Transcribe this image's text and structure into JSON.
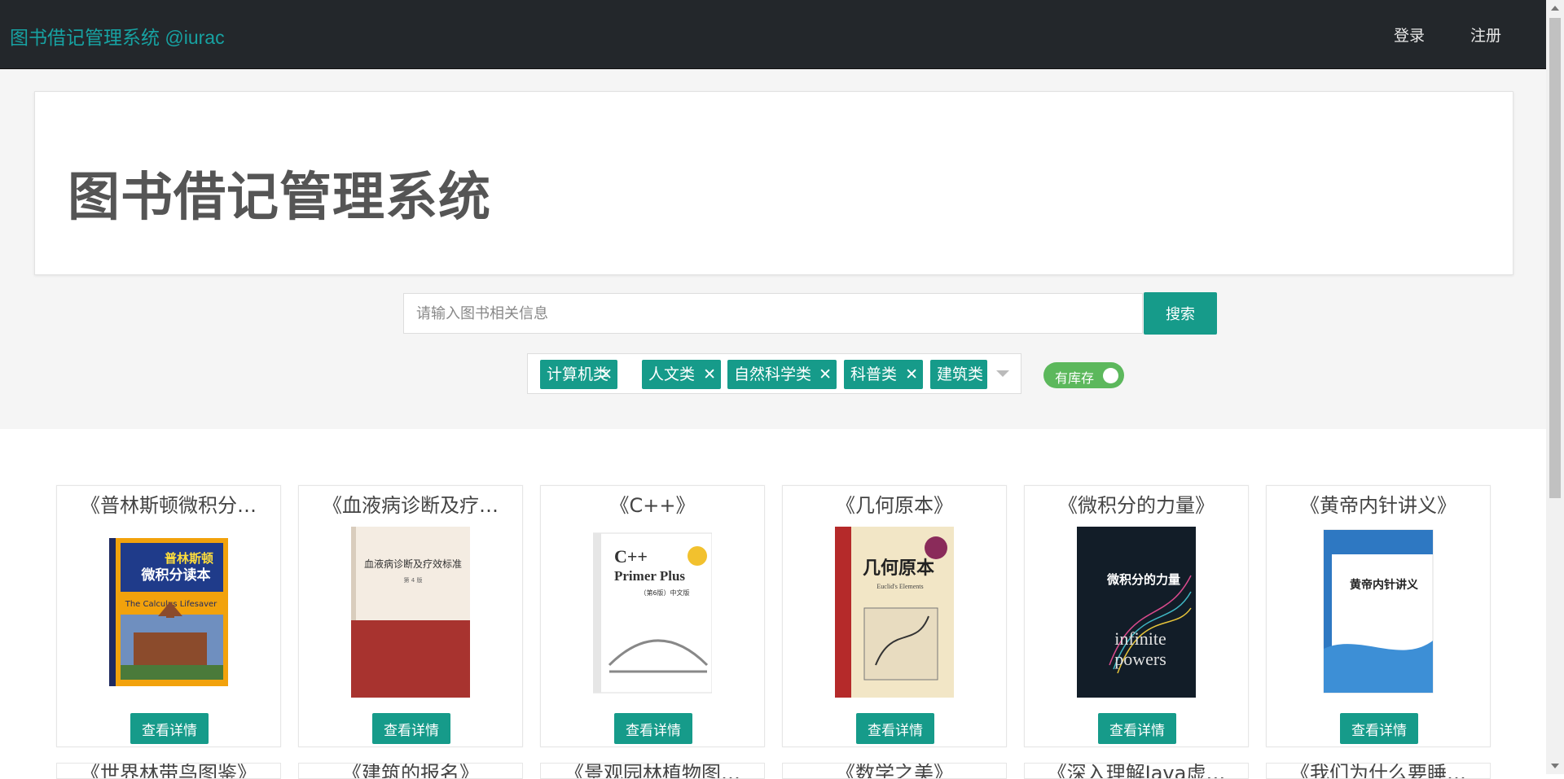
{
  "navbar": {
    "brand": "图书借记管理系统 @iurac",
    "login": "登录",
    "register": "注册"
  },
  "hero": {
    "title": "图书借记管理系统"
  },
  "search": {
    "placeholder": "请输入图书相关信息",
    "button": "搜索"
  },
  "filters": {
    "tags": [
      {
        "label": "计算机类",
        "remove": "✕"
      },
      {
        "label": "人文类",
        "remove": "✕"
      },
      {
        "label": "自然科学类",
        "remove": "✕"
      },
      {
        "label": "科普类",
        "remove": "✕"
      },
      {
        "label": "建筑类"
      }
    ],
    "in_stock_toggle": "有库存"
  },
  "books": [
    {
      "title": "《普林斯顿微积分…",
      "cover_text": "普林斯顿\n微积分读本",
      "cover_sub": "The Calculus Lifesaver",
      "button": "查看详情"
    },
    {
      "title": "《血液病诊断及疗…",
      "cover_text": "血液病诊断及疗效标准",
      "button": "查看详情"
    },
    {
      "title": "《C++》",
      "cover_text": "C++ Primer Plus",
      "cover_sub": "（第6版）中文版",
      "button": "查看详情"
    },
    {
      "title": "《几何原本》",
      "cover_text": "几何原本",
      "cover_sub": "Euclid's Elements",
      "button": "查看详情"
    },
    {
      "title": "《微积分的力量》",
      "cover_text": "微积分的力量",
      "cover_sub": "infinite powers",
      "button": "查看详情"
    },
    {
      "title": "《黄帝内针讲义》",
      "cover_text": "黄帝内针讲义",
      "button": "查看详情"
    }
  ],
  "books_row2": [
    {
      "title": "《世界林带鸟图鉴》"
    },
    {
      "title": "《建筑的报名》"
    },
    {
      "title": "《景观园林植物图…"
    },
    {
      "title": "《数学之美》"
    },
    {
      "title": "《深入理解Java虚…"
    },
    {
      "title": "《我们为什么要睡…"
    }
  ],
  "colors": {
    "accent": "#169b8a",
    "navbar": "#23272b",
    "brand": "#17a2a2",
    "toggle_on": "#5cb85c"
  }
}
